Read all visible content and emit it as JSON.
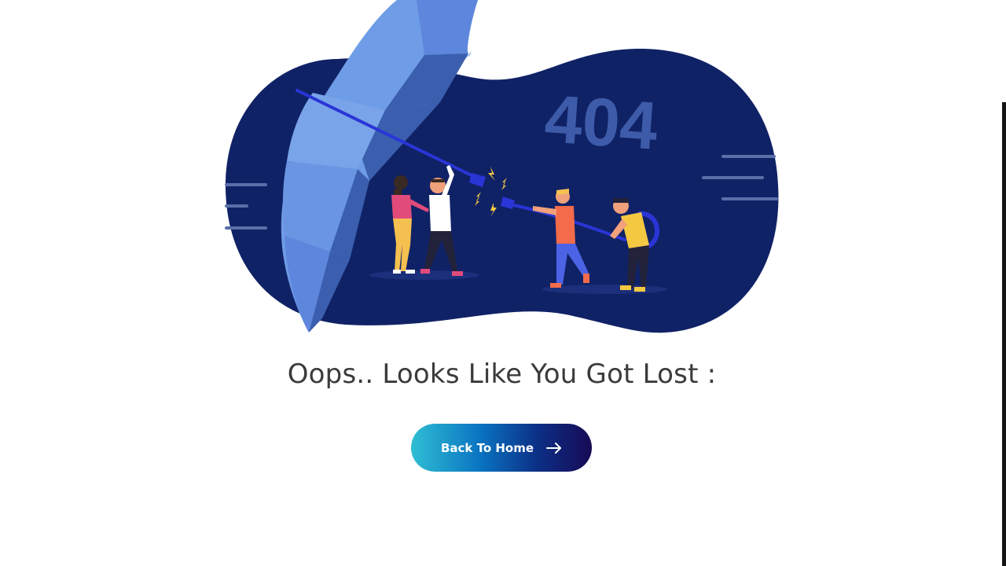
{
  "illustration": {
    "code_text": "404"
  },
  "heading": {
    "text": "Oops.. Looks Like You Got Lost :"
  },
  "home_button": {
    "label": "Back To Home",
    "icon": "arrow-right-icon"
  },
  "colors": {
    "blob": "#102266",
    "umbrella_light": "#6f9ce6",
    "umbrella_dark": "#3b5fae",
    "button_start": "#2fbed3",
    "button_end": "#170a55",
    "heading": "#3b3b3b"
  }
}
